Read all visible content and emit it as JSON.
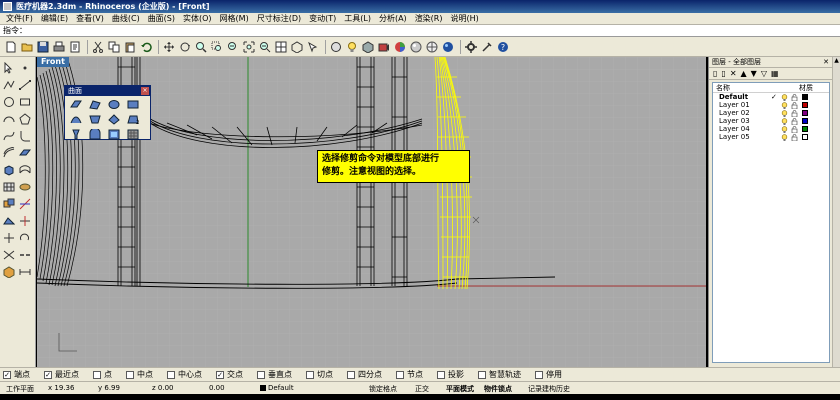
{
  "window": {
    "title": "医疗机器2.3dm - Rhinoceros (企业版) - [Front]"
  },
  "menu": [
    "文件(F)",
    "编辑(E)",
    "查看(V)",
    "曲线(C)",
    "曲面(S)",
    "实体(O)",
    "网格(M)",
    "尺寸标注(D)",
    "变动(T)",
    "工具(L)",
    "分析(A)",
    "渲染(R)",
    "说明(H)"
  ],
  "command": {
    "label": "指令：",
    "value": ""
  },
  "viewport": {
    "label": "Front"
  },
  "float_toolbar": {
    "title": "曲面",
    "close": "×"
  },
  "note": {
    "line1": "选择修剪命令对模型底部进行",
    "line2": "修剪。注意视图的选择。"
  },
  "layers": {
    "title": "图层 - 全部图层",
    "col_name": "名称",
    "col_material": "材质",
    "rows": [
      {
        "name": "Default",
        "current": true,
        "color": "#000000"
      },
      {
        "name": "Layer 01",
        "current": false,
        "color": "#c00000"
      },
      {
        "name": "Layer 02",
        "current": false,
        "color": "#800080"
      },
      {
        "name": "Layer 03",
        "current": false,
        "color": "#0000c0"
      },
      {
        "name": "Layer 04",
        "current": false,
        "color": "#008000"
      },
      {
        "name": "Layer 05",
        "current": false,
        "color": "#ffffff"
      }
    ],
    "checkmark": "✓"
  },
  "osnaps": [
    {
      "label": "端点",
      "checked": true
    },
    {
      "label": "最近点",
      "checked": true
    },
    {
      "label": "点",
      "checked": false
    },
    {
      "label": "中点",
      "checked": false
    },
    {
      "label": "中心点",
      "checked": false
    },
    {
      "label": "交点",
      "checked": true
    },
    {
      "label": "垂直点",
      "checked": false
    },
    {
      "label": "切点",
      "checked": false
    },
    {
      "label": "四分点",
      "checked": false
    },
    {
      "label": "节点",
      "checked": false
    },
    {
      "label": "投影",
      "checked": false
    },
    {
      "label": "智慧轨迹",
      "checked": false
    },
    {
      "label": "停用",
      "checked": false
    }
  ],
  "status": {
    "cplane": "工作平面",
    "x": "x 19.36",
    "y": "y 6.99",
    "z": "z 0.00",
    "unit": "0.00",
    "layer": "Default",
    "grid_snap": "锁定格点",
    "ortho": "正交",
    "planar": "平面模式",
    "object_snap": "物件锁点",
    "history": "记录建构历史"
  },
  "colors": {
    "selected_curve": "#ffff00",
    "wire": "#000000",
    "grid": "#b8b8b8",
    "axis_green": "#2d8a2d",
    "axis_red": "#a03030"
  }
}
